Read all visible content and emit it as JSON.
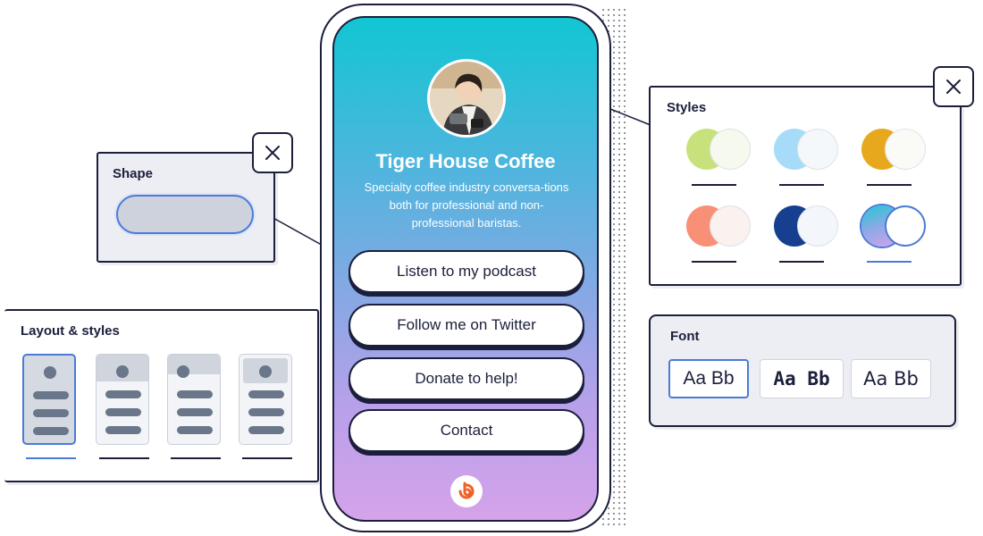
{
  "shape_panel": {
    "title": "Shape"
  },
  "layout_panel": {
    "title": "Layout & styles",
    "selected_index": 0
  },
  "styles_panel": {
    "title": "Styles",
    "swatches": [
      {
        "primary": "#c7e27c",
        "secondary": "#f6f9ee",
        "selected": false
      },
      {
        "primary": "#a6dcf7",
        "secondary": "#f4f8fb",
        "selected": false
      },
      {
        "primary": "#e7a81d",
        "secondary": "#fafaf6",
        "selected": false
      },
      {
        "primary": "#f88f77",
        "secondary": "#fbf1ef",
        "selected": false
      },
      {
        "primary": "#173f8f",
        "secondary": "#f3f6fb",
        "selected": false
      },
      {
        "primary": "gradient-teal-violet",
        "secondary": "#ffffff",
        "selected": true
      }
    ]
  },
  "font_panel": {
    "title": "Font",
    "options": [
      {
        "label": "Aa Bb",
        "selected": true
      },
      {
        "label": "Aa Bb",
        "selected": false
      },
      {
        "label": "Aa Bb",
        "selected": false
      }
    ]
  },
  "profile": {
    "name": "Tiger House Coffee",
    "bio": "Specialty coffee industry conversa-tions both for professional and non-professional baristas.",
    "links": [
      "Listen to my podcast",
      "Follow me on Twitter",
      "Donate to help!",
      "Contact"
    ]
  },
  "colors": {
    "ink": "#1b1f3b",
    "accent": "#4a7bd6",
    "brand": "#ee6123"
  }
}
